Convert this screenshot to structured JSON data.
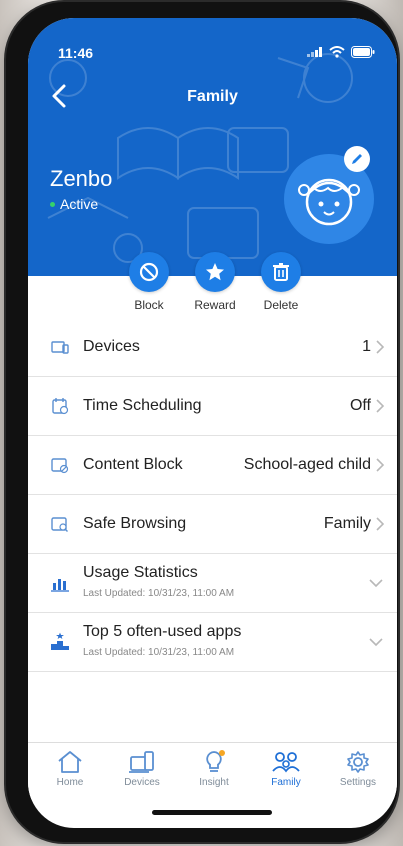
{
  "status_bar": {
    "time": "11:46"
  },
  "header": {
    "title": "Family",
    "child_name": "Zenbo",
    "child_status": "Active"
  },
  "actions": [
    {
      "label": "Block",
      "icon": "block-icon"
    },
    {
      "label": "Reward",
      "icon": "star-icon"
    },
    {
      "label": "Delete",
      "icon": "trash-icon"
    }
  ],
  "settings": [
    {
      "label": "Devices",
      "value": "1",
      "icon": "devices-icon"
    },
    {
      "label": "Time Scheduling",
      "value": "Off",
      "icon": "calendar-icon"
    },
    {
      "label": "Content Block",
      "value": "School-aged child",
      "icon": "content-block-icon"
    },
    {
      "label": "Safe Browsing",
      "value": "Family",
      "icon": "safe-browsing-icon"
    },
    {
      "label": "Usage Statistics",
      "sub": "Last Updated: 10/31/23, 11:00 AM",
      "icon": "bar-chart-icon"
    },
    {
      "label": "Top 5 often-used apps",
      "sub": "Last Updated: 10/31/23, 11:00 AM",
      "icon": "podium-icon"
    }
  ],
  "bottom_nav": [
    {
      "label": "Home",
      "icon": "home-icon"
    },
    {
      "label": "Devices",
      "icon": "devices-icon"
    },
    {
      "label": "Insight",
      "icon": "lightbulb-icon"
    },
    {
      "label": "Family",
      "icon": "family-icon",
      "active": true
    },
    {
      "label": "Settings",
      "icon": "gear-icon"
    }
  ],
  "colors": {
    "header_blue": "#1466c9",
    "accent_blue": "#1e7ee6",
    "active_dot": "#36d26a",
    "notification_dot": "#f5a623"
  }
}
